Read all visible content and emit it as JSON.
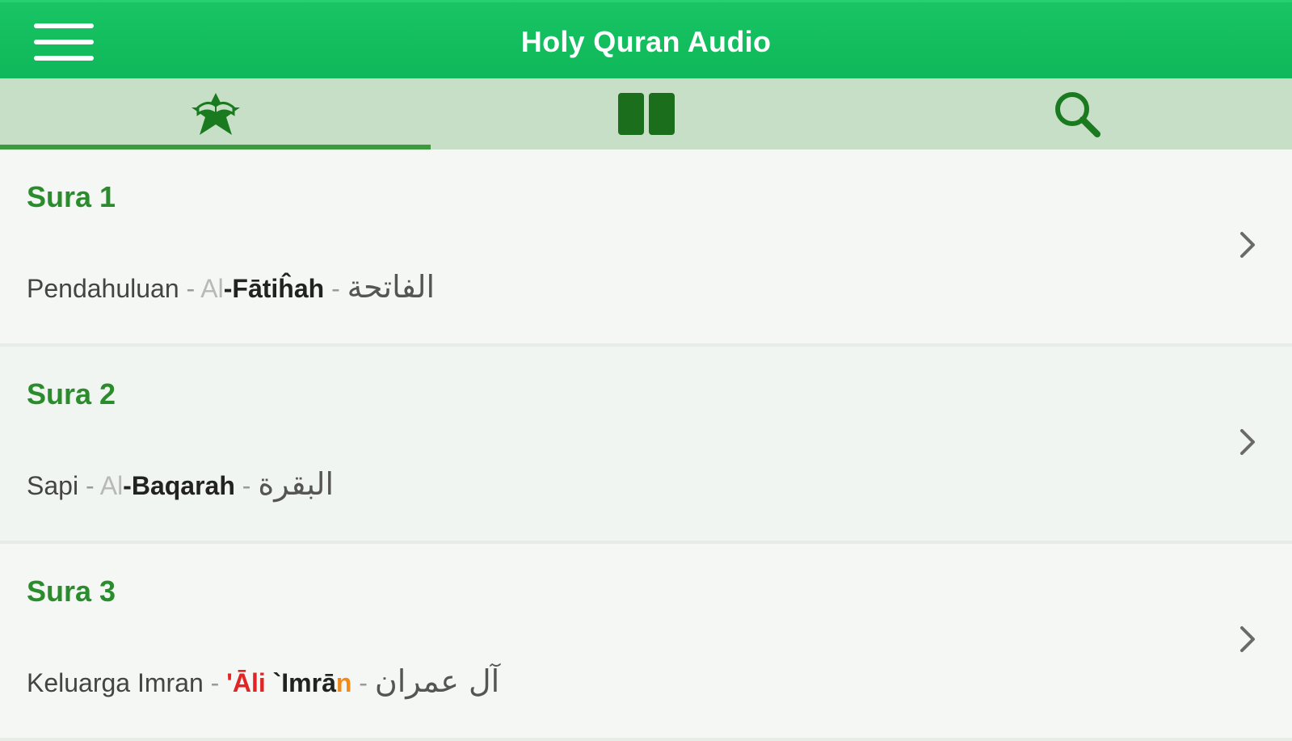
{
  "header": {
    "title": "Holy Quran Audio",
    "menu_icon": "hamburger-menu-icon"
  },
  "tabs": [
    {
      "icon": "quran-book-star-icon",
      "selected": true
    },
    {
      "icon": "open-book-icon",
      "selected": false
    },
    {
      "icon": "search-icon",
      "selected": false
    }
  ],
  "colors": {
    "header_green": "#15c060",
    "tabbar_bg": "#c6dfc6",
    "accent_green": "#2a8c2c",
    "highlight_red": "#e12424",
    "highlight_orange": "#f08a1a"
  },
  "suras": [
    {
      "title": "Sura 1",
      "translation": "Pendahuluan",
      "sep1": "-",
      "translit_soft": "Al",
      "translit_strong": "-Fātiĥah",
      "sep2": "-",
      "arabic": "الفاتحة"
    },
    {
      "title": "Sura 2",
      "translation": "Sapi",
      "sep1": "-",
      "translit_soft": "Al",
      "translit_strong": "-Baqarah",
      "sep2": "-",
      "arabic": "البقرة"
    },
    {
      "title": "Sura 3",
      "translation": "Keluarga Imran",
      "sep1": "-",
      "translit_red": "'Āli",
      "translit_strong": "`Imrā",
      "translit_orange": "n",
      "sep2": "-",
      "arabic": "آل عمران"
    }
  ]
}
